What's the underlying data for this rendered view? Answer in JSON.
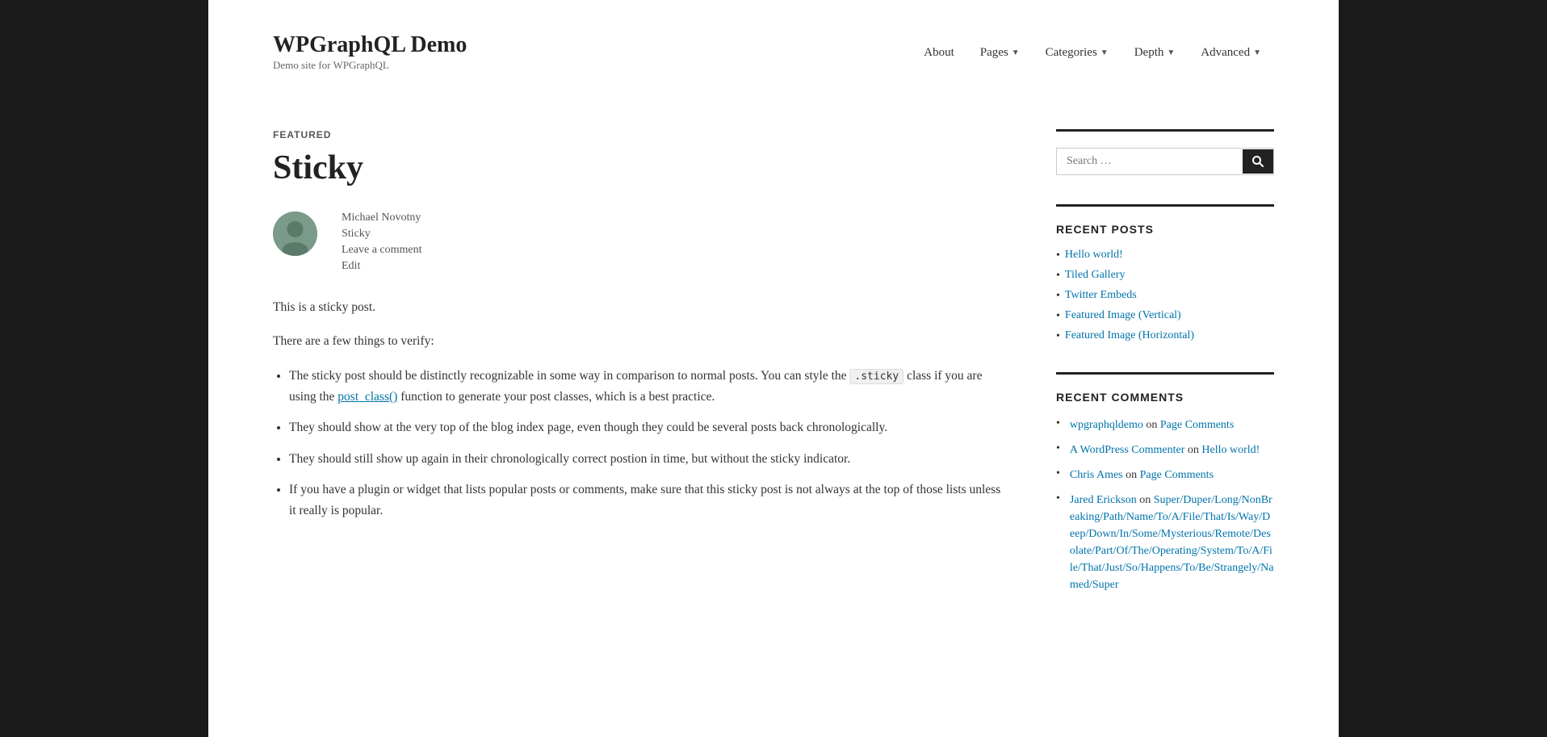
{
  "site": {
    "title": "WPGraphQL Demo",
    "description": "Demo site for WPGraphQL"
  },
  "nav": {
    "items": [
      {
        "label": "About",
        "hasDropdown": false
      },
      {
        "label": "Pages",
        "hasDropdown": true
      },
      {
        "label": "Categories",
        "hasDropdown": true
      },
      {
        "label": "Depth",
        "hasDropdown": true
      },
      {
        "label": "Advanced",
        "hasDropdown": true
      }
    ]
  },
  "post": {
    "featured_label": "FEATURED",
    "title": "Sticky",
    "author_name": "Michael Novotny",
    "category": "Sticky",
    "leave_comment": "Leave a comment",
    "edit": "Edit",
    "intro_1": "This is a sticky post.",
    "intro_2": "There are a few things to verify:",
    "bullets": [
      "The sticky post should be distinctly recognizable in some way in comparison to normal posts. You can style the .sticky class if you are using the post_class() function to generate your post classes, which is a best practice.",
      "They should show at the very top of the blog index page, even though they could be several posts back chronologically.",
      "They should still show up again in their chronologically correct postion in time, but without the sticky indicator.",
      "If you have a plugin or widget that lists popular posts or comments, make sure that this sticky post is not always at the top of those lists unless it really is popular."
    ],
    "sticky_class": ".sticky",
    "post_class_func": "post_class()"
  },
  "sidebar": {
    "search": {
      "placeholder": "Search …",
      "button_label": "Search"
    },
    "recent_posts": {
      "title": "RECENT POSTS",
      "items": [
        {
          "label": "Hello world!"
        },
        {
          "label": "Tiled Gallery"
        },
        {
          "label": "Twitter Embeds"
        },
        {
          "label": "Featured Image (Vertical)"
        },
        {
          "label": "Featured Image (Horizontal)"
        }
      ]
    },
    "recent_comments": {
      "title": "RECENT COMMENTS",
      "items": [
        {
          "author": "wpgraphqldemo",
          "connector": "on",
          "link_text": "Page Comments"
        },
        {
          "author": "A WordPress Commenter",
          "connector": "on",
          "link_text": "Hello world!"
        },
        {
          "author": "Chris Ames",
          "connector": "on",
          "link_text": "Page Comments"
        },
        {
          "author": "Jared Erickson",
          "connector": "on",
          "link_text": "Super/Duper/Long/NonBreaking/Path/Name/To/A/File/That/Is/Way/Deep/Down/In/Some/Mysterious/Remote/Desolate/Part/Of/The/Operating/System/To/A/File/That/Just/So/Happens/To/Be/Strangely/Named/Super"
        }
      ]
    }
  }
}
